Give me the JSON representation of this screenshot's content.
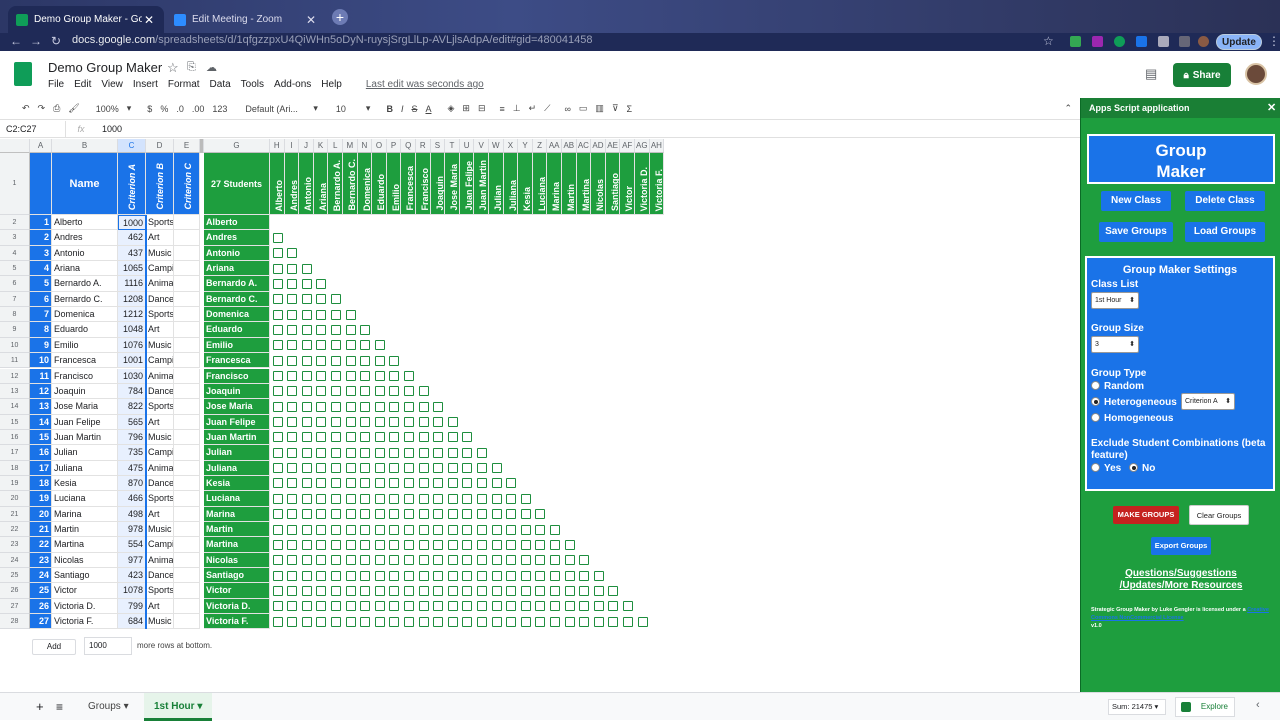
{
  "browser": {
    "tabs": [
      {
        "title": "Demo Group Maker - Google S",
        "close": "✕"
      },
      {
        "title": "Edit Meeting - Zoom",
        "close": "✕"
      }
    ],
    "new_tab": "+",
    "url_host": "docs.google.com",
    "url_path": "/spreadsheets/d/1qfgzzpxU4QiWHn5oDyN-ruysjSrgLlLp-AVLjlsAdpA/edit#gid=480041458",
    "update_label": "Update"
  },
  "sheets": {
    "title": "Demo Group Maker",
    "menu": [
      "File",
      "Edit",
      "View",
      "Insert",
      "Format",
      "Data",
      "Tools",
      "Add-ons",
      "Help"
    ],
    "last_edit": "Last edit was seconds ago",
    "share_label": "Share",
    "toolbar": {
      "zoom": "100%",
      "currency": "$",
      "percent": "%",
      "dec1": ".0",
      "dec2": ".00",
      "fmt": "123",
      "font": "Default (Ari...",
      "size": "10",
      "bold": "B",
      "italic": "I",
      "strike": "S",
      "textcolor": "A"
    },
    "cell_ref": "C2:C27",
    "fx": "fx",
    "formula_value": "1000"
  },
  "grid": {
    "col_letters_left": [
      "A",
      "B",
      "C",
      "D",
      "E"
    ],
    "col_letters_right": [
      "G",
      "H",
      "I",
      "J",
      "K",
      "L",
      "M",
      "N",
      "O",
      "P",
      "Q",
      "R",
      "S",
      "T",
      "U",
      "V",
      "W",
      "X",
      "Y",
      "Z",
      "AA",
      "AB",
      "AC",
      "AD",
      "AE",
      "AF",
      "AG",
      "AH"
    ],
    "header": {
      "name": "Name",
      "crit_a": "Criterion A",
      "crit_b": "Criterion B",
      "crit_c": "Criterion C",
      "students": "27 Students"
    },
    "students": [
      {
        "n": "1",
        "name": "Alberto",
        "a": "1000",
        "b": "Sports"
      },
      {
        "n": "2",
        "name": "Andres",
        "a": "462",
        "b": "Art"
      },
      {
        "n": "3",
        "name": "Antonio",
        "a": "437",
        "b": "Music"
      },
      {
        "n": "4",
        "name": "Ariana",
        "a": "1065",
        "b": "Camping"
      },
      {
        "n": "5",
        "name": "Bernardo A.",
        "a": "1116",
        "b": "Animals"
      },
      {
        "n": "6",
        "name": "Bernardo C.",
        "a": "1208",
        "b": "Dance"
      },
      {
        "n": "7",
        "name": "Domenica",
        "a": "1212",
        "b": "Sports"
      },
      {
        "n": "8",
        "name": "Eduardo",
        "a": "1048",
        "b": "Art"
      },
      {
        "n": "9",
        "name": "Emilio",
        "a": "1076",
        "b": "Music"
      },
      {
        "n": "10",
        "name": "Francesca",
        "a": "1001",
        "b": "Camping"
      },
      {
        "n": "11",
        "name": "Francisco",
        "a": "1030",
        "b": "Animals"
      },
      {
        "n": "12",
        "name": "Joaquin",
        "a": "784",
        "b": "Dance"
      },
      {
        "n": "13",
        "name": "Jose Maria",
        "a": "822",
        "b": "Sports"
      },
      {
        "n": "14",
        "name": "Juan Felipe",
        "a": "565",
        "b": "Art"
      },
      {
        "n": "15",
        "name": "Juan Martin",
        "a": "796",
        "b": "Music"
      },
      {
        "n": "16",
        "name": "Julian",
        "a": "735",
        "b": "Camping"
      },
      {
        "n": "17",
        "name": "Juliana",
        "a": "475",
        "b": "Animals"
      },
      {
        "n": "18",
        "name": "Kesia",
        "a": "870",
        "b": "Dance"
      },
      {
        "n": "19",
        "name": "Luciana",
        "a": "466",
        "b": "Sports"
      },
      {
        "n": "20",
        "name": "Marina",
        "a": "498",
        "b": "Art"
      },
      {
        "n": "21",
        "name": "Martin",
        "a": "978",
        "b": "Music"
      },
      {
        "n": "22",
        "name": "Martina",
        "a": "554",
        "b": "Camping"
      },
      {
        "n": "23",
        "name": "Nicolas",
        "a": "977",
        "b": "Animals"
      },
      {
        "n": "24",
        "name": "Santiago",
        "a": "423",
        "b": "Dance"
      },
      {
        "n": "25",
        "name": "Victor",
        "a": "1078",
        "b": "Sports"
      },
      {
        "n": "26",
        "name": "Victoria D.",
        "a": "799",
        "b": "Art"
      },
      {
        "n": "27",
        "name": "Victoria F.",
        "a": "684",
        "b": "Music"
      }
    ],
    "add_label": "Add",
    "add_rows": "1000",
    "add_suffix": "more rows at bottom."
  },
  "bottom": {
    "add_sheet": "+",
    "sheets_menu": "≡",
    "tabs": [
      "Groups",
      "1st Hour"
    ],
    "sum": "Sum: 21475",
    "explore": "Explore"
  },
  "panel": {
    "header": "Apps Script application",
    "close": "✕",
    "title_line1": "Group",
    "title_line2": "Maker",
    "new_class": "New Class",
    "delete_class": "Delete Class",
    "save_groups": "Save Groups",
    "load_groups": "Load Groups",
    "settings_title": "Group Maker Settings",
    "class_list_label": "Class List",
    "class_list_value": "1st Hour",
    "group_size_label": "Group Size",
    "group_size_value": "3",
    "group_type_label": "Group Type",
    "types": [
      "Random",
      "Heterogeneous",
      "Homogeneous"
    ],
    "criterion_value": "Criterion A",
    "exclude_label": "Exclude Student Combinations (beta feature)",
    "yes": "Yes",
    "no": "No",
    "make_groups": "MAKE GROUPS",
    "clear_groups": "Clear Groups",
    "export_groups": "Export Groups",
    "questions_line1": "Questions/Suggestions",
    "questions_line2": "/Updates/More Resources",
    "license": "Strategic Group Maker by Luke Gengler is licensed under a",
    "license_link": "Creative Commons NonCommercial License",
    "version": "v1.0"
  },
  "colors": {
    "blue": "#1a73e8",
    "green": "#1e9e3e",
    "red": "#c5221f"
  }
}
